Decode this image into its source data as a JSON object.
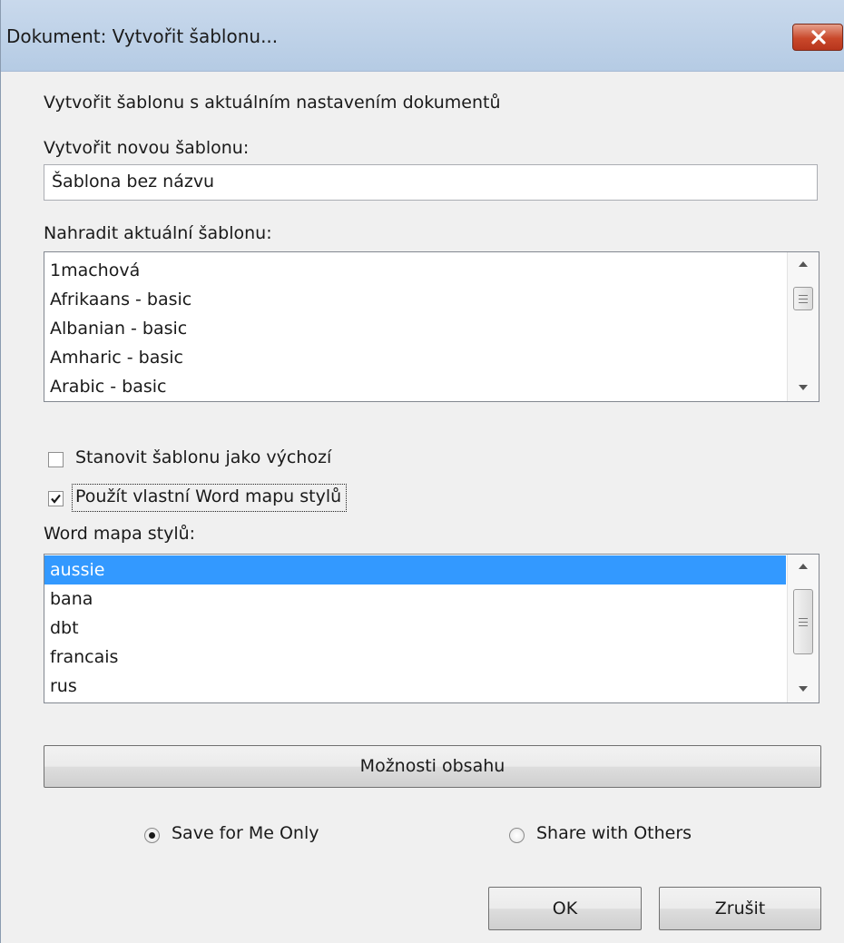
{
  "window": {
    "title": "Dokument: Vytvořit šablonu..."
  },
  "form": {
    "intro": "Vytvořit šablonu s aktuálním nastavením dokumentů",
    "new_template_label": "Vytvořit novou šablonu:",
    "new_template_value": "Šablona bez názvu",
    "replace_label": "Nahradit aktuální šablonu:",
    "templates": [
      "1machová",
      "Afrikaans - basic",
      "Albanian - basic",
      "Amharic - basic",
      "Arabic - basic"
    ],
    "default_checkbox": {
      "label": "Stanovit šablonu jako výchozí",
      "checked": false
    },
    "word_map_checkbox": {
      "label": "Použít vlastní Word mapu stylů",
      "checked": true
    },
    "word_map_label": "Word mapa stylů:",
    "word_maps": [
      "aussie",
      "bana",
      "dbt",
      "francais",
      "rus"
    ],
    "word_map_selected": "aussie",
    "content_options_button": "Možnosti obsahu",
    "radio_me": {
      "label": "Save for Me Only",
      "selected": true
    },
    "radio_others": {
      "label": "Share with Others",
      "selected": false
    },
    "ok_button": "OK",
    "cancel_button": "Zrušit"
  },
  "colors": {
    "selection": "#3399ff",
    "titlebar": "#b5cbe4",
    "close_button": "#c9482a"
  }
}
